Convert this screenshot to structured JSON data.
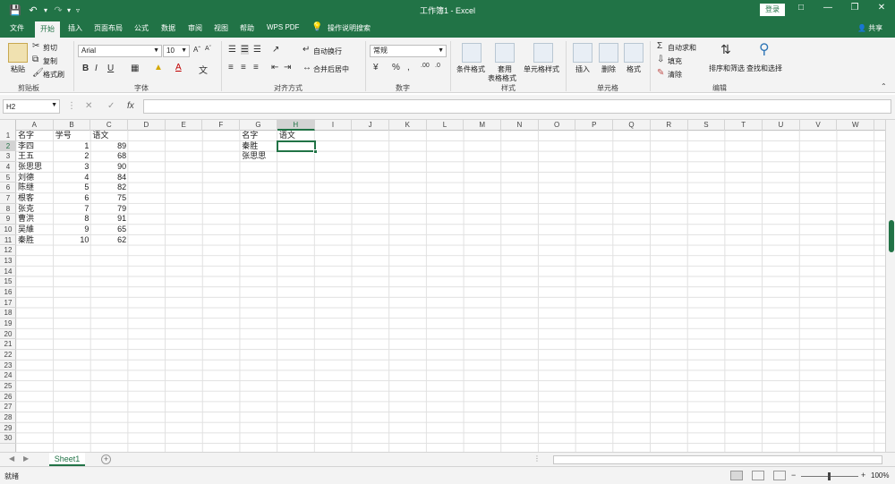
{
  "window": {
    "title": "工作簿1 - Excel",
    "login_label": "登录",
    "quick_access": [
      "save",
      "undo",
      "redo",
      "customize"
    ],
    "controls": [
      "ribbon-options",
      "minimize",
      "restore",
      "close"
    ]
  },
  "ribbon_tabs": [
    "文件",
    "开始",
    "插入",
    "页面布局",
    "公式",
    "数据",
    "审阅",
    "视图",
    "帮助",
    "WPS PDF"
  ],
  "active_tab": "开始",
  "tell_me": "操作说明搜索",
  "share_label": "共享",
  "clipboard": {
    "paste": "粘贴",
    "cut": "剪切",
    "copy": "复制",
    "format_painter": "格式刷",
    "group": "剪贴板"
  },
  "font": {
    "name": "Arial",
    "size": "10",
    "bold": "B",
    "italic": "I",
    "underline": "U",
    "group": "字体"
  },
  "alignment": {
    "wrap": "自动换行",
    "merge": "合并后居中",
    "group": "对齐方式"
  },
  "number": {
    "format": "常规",
    "group": "数字"
  },
  "styles": {
    "conditional": "条件格式",
    "table_line1": "套用",
    "table_line2": "表格格式",
    "cell_styles": "单元格样式",
    "group": "样式"
  },
  "cells_group": {
    "insert": "插入",
    "delete": "删除",
    "format": "格式",
    "group": "单元格"
  },
  "editing": {
    "autosum": "自动求和",
    "fill": "填充",
    "clear": "清除",
    "sort_filter": "排序和筛选",
    "find_select": "查找和选择",
    "group": "编辑"
  },
  "formula_bar": {
    "name_box": "H2",
    "fx": "fx",
    "formula": ""
  },
  "columns": [
    "A",
    "B",
    "C",
    "D",
    "E",
    "F",
    "G",
    "H",
    "I",
    "J",
    "K",
    "L",
    "M",
    "N",
    "O",
    "P",
    "Q",
    "R",
    "S",
    "T",
    "U",
    "V",
    "W"
  ],
  "selected_column": "H",
  "rows_count": 30,
  "selected_row": 2,
  "cells": {
    "A1": "名字",
    "B1": "学号",
    "C1": "语文",
    "A2": "李四",
    "B2": "1",
    "C2": "89",
    "A3": "王五",
    "B3": "2",
    "C3": "68",
    "A4": "张思思",
    "B4": "3",
    "C4": "90",
    "A5": "刘德",
    "B5": "4",
    "C5": "84",
    "A6": "陈继",
    "B6": "5",
    "C6": "82",
    "A7": "根客",
    "B7": "6",
    "C7": "75",
    "A8": "张克",
    "B8": "7",
    "C8": "79",
    "A9": "曹洪",
    "B9": "8",
    "C9": "91",
    "A10": "吴維",
    "B10": "9",
    "C10": "65",
    "A11": "秦胜",
    "B11": "10",
    "C11": "62",
    "G1": "名字",
    "H1": "语文",
    "G2": "秦胜",
    "G3": "张思思"
  },
  "sheet_tab": "Sheet1",
  "status": {
    "ready": "就绪",
    "zoom": "100%",
    "zoom_minus": "−",
    "zoom_plus": "+"
  },
  "colors": {
    "brand": "#217346",
    "ribbon_bg": "#f3f3f3"
  }
}
